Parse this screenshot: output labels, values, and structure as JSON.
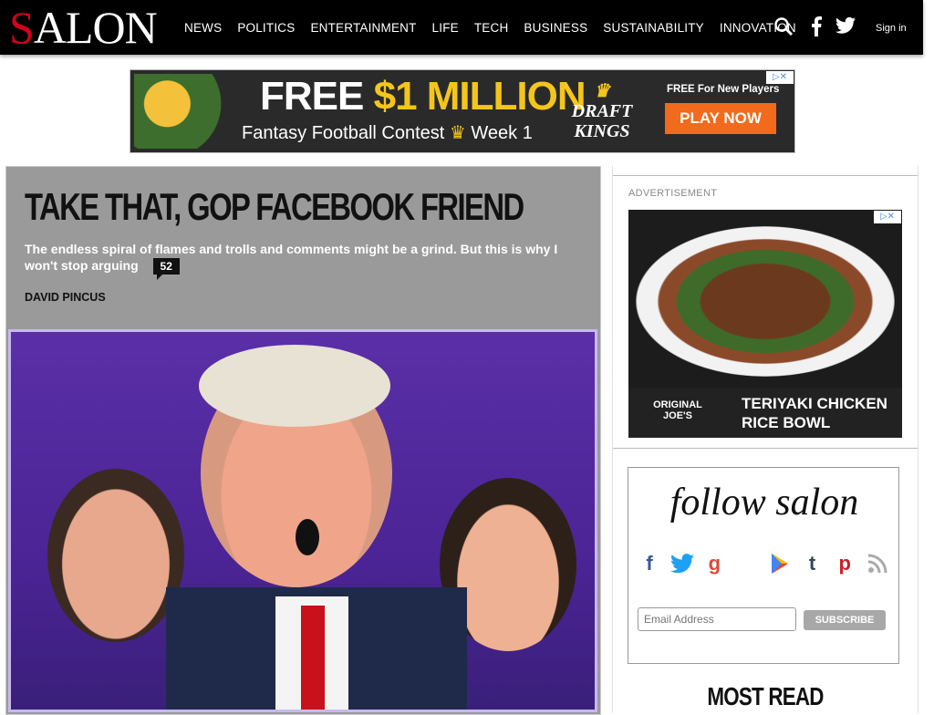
{
  "header": {
    "logo_first": "S",
    "logo_rest": "ALON",
    "nav": [
      "NEWS",
      "POLITICS",
      "ENTERTAINMENT",
      "LIFE",
      "TECH",
      "BUSINESS",
      "SUSTAINABILITY",
      "INNOVATION"
    ],
    "icons": [
      "search-icon",
      "facebook-icon",
      "twitter-icon"
    ],
    "signin_label": "Sign in"
  },
  "top_ad": {
    "headline_white": "FREE",
    "headline_gold": "$1 MILLION",
    "subline": "Fantasy Football Contest",
    "subline_suffix": "Week 1",
    "brand": "DRAFT KINGS",
    "free_for": "FREE For New Players",
    "cta": "PLAY NOW"
  },
  "article": {
    "title": "TAKE THAT, GOP FACEBOOK FRIEND",
    "dek": "The endless spiral of flames and trolls and comments might be a grind. But this is why I won't stop arguing",
    "comment_count": "52",
    "author": "DAVID PINCUS"
  },
  "sidebar": {
    "ad_label": "ADVERTISEMENT",
    "ad_brand": "ORIGINAL JOE'S",
    "ad_dish_line1": "TERIYAKI CHICKEN",
    "ad_dish_line2": "RICE BOWL",
    "follow_title": "follow salon",
    "social_icons": [
      "facebook-icon",
      "twitter-icon",
      "google-plus-icon",
      "apple-icon",
      "google-play-icon",
      "tumblr-icon",
      "pinterest-icon",
      "rss-icon"
    ],
    "email_placeholder": "Email Address",
    "subscribe_label": "SUBSCRIBE",
    "most_read": "MOST READ"
  },
  "colors": {
    "brand_red": "#d0021b",
    "header_bg": "#000000",
    "article_bg": "#9a9a9a",
    "cta_orange": "#f26a1b"
  }
}
